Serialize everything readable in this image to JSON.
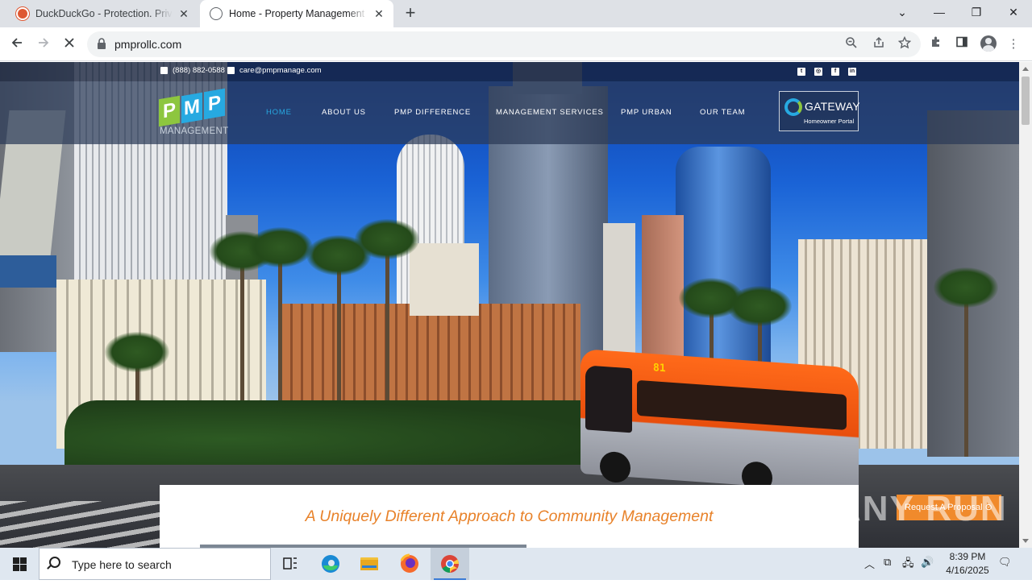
{
  "browser": {
    "tabs": [
      {
        "title": "DuckDuckGo - Protection. Privacy. Peace of mind.",
        "active": false
      },
      {
        "title": "Home - Property Management Professionals",
        "active": true
      }
    ],
    "new_tab": "+",
    "url": "pmprollc.com",
    "window_controls": {
      "minimize": "—",
      "maximize": "❐",
      "close": "✕",
      "tab_search": "⌄"
    }
  },
  "site": {
    "phone": "(888) 882-0588",
    "email": "care@pmpmanage.com",
    "social": [
      "twitter",
      "instagram",
      "facebook",
      "linkedin"
    ],
    "logo": {
      "letters": [
        "P",
        "M",
        "P"
      ],
      "sub": "MANAGEMENT",
      "colors": [
        "#8dc63f",
        "#27a9e1",
        "#27a9e1"
      ]
    },
    "nav": [
      {
        "label": "HOME",
        "active": true
      },
      {
        "label": "ABOUT US",
        "active": false
      },
      {
        "label": "PMP DIFFERENCE",
        "active": false
      },
      {
        "label": "MANAGEMENT SERVICES",
        "active": false
      },
      {
        "label": "PMP URBAN",
        "active": false
      },
      {
        "label": "OUR TEAM",
        "active": false
      }
    ],
    "gateway": {
      "title": "GATEWAY",
      "subtitle": "Homeowner Portal"
    },
    "headline": "A Uniquely Different Approach to Community Management",
    "proposal_button": "Request A Proposal ⊙",
    "bus_route": "81",
    "watermark": "ANY RUN",
    "accent_color": "#e8822a",
    "nav_active_color": "#27a9e1"
  },
  "taskbar": {
    "search_placeholder": "Type here to search",
    "time": "8:39 PM",
    "date": "4/16/2025"
  }
}
